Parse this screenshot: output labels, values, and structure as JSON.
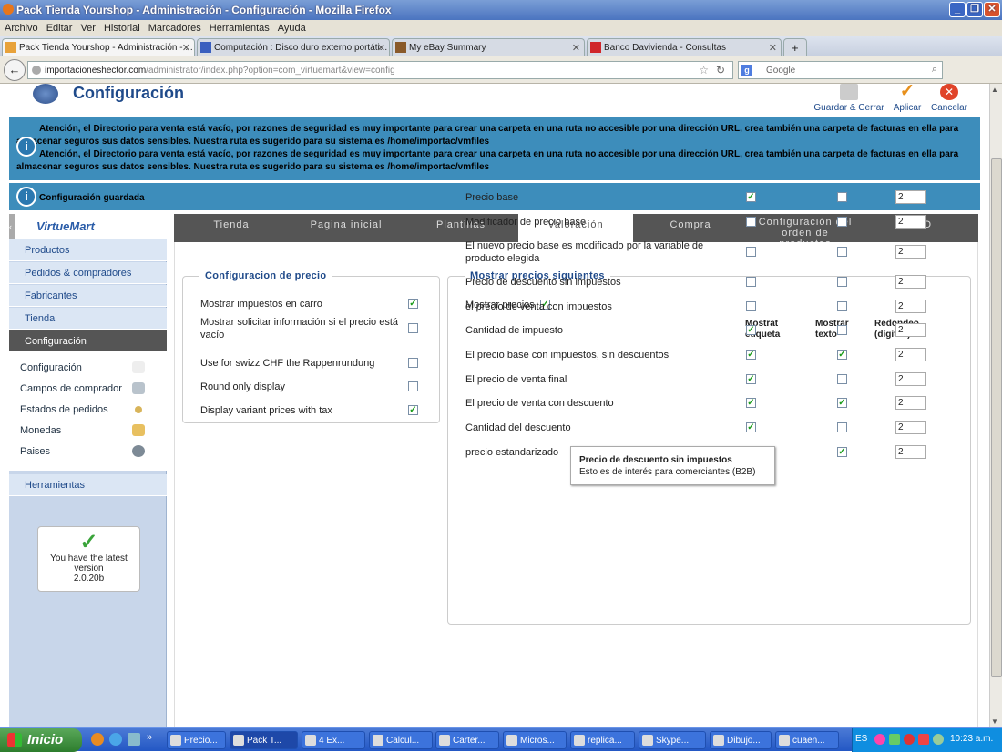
{
  "window": {
    "title": "Pack Tienda Yourshop - Administración - Configuración - Mozilla Firefox"
  },
  "menu": [
    "Archivo",
    "Editar",
    "Ver",
    "Historial",
    "Marcadores",
    "Herramientas",
    "Ayuda"
  ],
  "tabs": [
    "Pack Tienda Yourshop - Administración - ...",
    "Computación : Disco duro externo portáti...",
    "My eBay Summary",
    "Banco Davivienda - Consultas"
  ],
  "url": {
    "domain": "importacioneshector.com",
    "path": "/administrator/index.php?option=com_virtuemart&view=config"
  },
  "search_placeholder": "Google",
  "page": {
    "title": "Configuración",
    "toolbar": {
      "save_close": "Guardar & Cerrar",
      "apply": "Aplicar",
      "cancel": "Cancelar"
    },
    "warning": [
      "Atención, el Directorio para venta está vacío, por razones de seguridad es muy importante para crear una carpeta en una ruta no accesible por una dirección URL, crea también una carpeta de facturas en ella para almacenar seguros sus datos sensibles. Nuestra ruta es sugerido para su sistema es /home/importac/vmfiles",
      "Atención, el Directorio para venta está vacío, por razones de seguridad es muy importante para crear una carpeta en una ruta no accesible por una dirección URL, crea también una carpeta de facturas en ella para almacenar seguros sus datos sensibles. Nuestra ruta es sugerido para su sistema es /home/importac/vmfiles"
    ],
    "saved": "Configuración guardada"
  },
  "sidebar": {
    "logo": "VirtueMart",
    "items": [
      "Productos",
      "Pedidos & compradores",
      "Fabricantes",
      "Tienda",
      "Configuración"
    ],
    "subitems": [
      "Configuración",
      "Campos de comprador",
      "Estados de pedidos",
      "Monedas",
      "Paises"
    ],
    "tools": "Herramientas",
    "latest": {
      "line1": "You have the latest",
      "line2": "version",
      "line3": "2.0.20b"
    }
  },
  "maintabs": [
    "Tienda",
    "Pagina inicial",
    "Plantillas",
    "Valoración",
    "Compra",
    "Configuración del orden de productos",
    "SEO"
  ],
  "price_config": {
    "legend": "Configuracion de precio",
    "options": [
      {
        "label": "Mostrar impuestos en carro",
        "checked": true
      },
      {
        "label": "Mostrar solicitar información si el precio está vacío",
        "checked": false
      },
      {
        "label": "Use for swizz CHF the Rappenrundung",
        "checked": false
      },
      {
        "label": "Round only display",
        "checked": false
      },
      {
        "label": "Display variant prices with tax",
        "checked": true
      }
    ]
  },
  "show_prices": {
    "legend": "Mostrar precios siguientes",
    "show_label": "Mostrar precios",
    "show_checked": true,
    "headers": [
      "Mostrat etiqueta",
      "Mostrar texto",
      "Redondeo (dígitos)"
    ],
    "rows": [
      {
        "label": "Precio base",
        "etiqueta": true,
        "texto": false,
        "digits": "2"
      },
      {
        "label": "Modificador de precio base",
        "etiqueta": false,
        "texto": false,
        "digits": "2"
      },
      {
        "label": "El nuevo precio base es modificado por la variable de producto elegida",
        "etiqueta": false,
        "texto": false,
        "digits": "2"
      },
      {
        "label": "Precio de descuento sin impuestos",
        "etiqueta": false,
        "texto": false,
        "digits": "2"
      },
      {
        "label": "el precio de venta con impuestos",
        "etiqueta": false,
        "texto": false,
        "digits": "2"
      },
      {
        "label": "Cantidad de impuesto",
        "etiqueta": true,
        "texto": false,
        "digits": "2"
      },
      {
        "label": "El precio base con impuestos, sin descuentos",
        "etiqueta": true,
        "texto": true,
        "digits": "2"
      },
      {
        "label": "El precio de venta final",
        "etiqueta": true,
        "texto": false,
        "digits": "2"
      },
      {
        "label": "El precio de venta con descuento",
        "etiqueta": true,
        "texto": true,
        "digits": "2"
      },
      {
        "label": "Cantidad del descuento",
        "etiqueta": true,
        "texto": false,
        "digits": "2"
      },
      {
        "label": "precio estandarizado",
        "etiqueta": false,
        "texto": true,
        "digits": "2"
      }
    ],
    "tooltip": {
      "title": "Precio de descuento sin impuestos",
      "text": "Esto es de interés para comerciantes (B2B)"
    }
  },
  "taskbar": {
    "start": "Inicio",
    "items": [
      "Precio...",
      "Pack T...",
      "4 Ex...",
      "Calcul...",
      "Carter...",
      "Micros...",
      "replica...",
      "Skype...",
      "Dibujo...",
      "cuaen..."
    ],
    "lang": "ES",
    "clock": "10:23 a.m."
  }
}
